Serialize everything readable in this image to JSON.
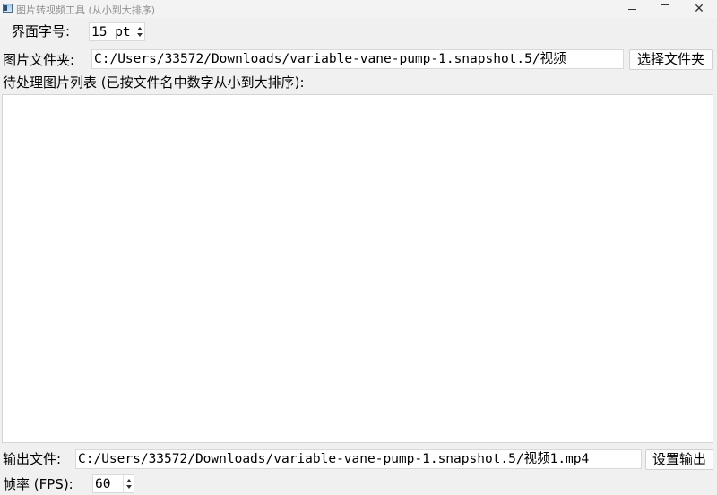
{
  "window": {
    "title": "图片转视频工具 (从小到大排序)",
    "icon": "app-window-icon"
  },
  "font_size": {
    "label": "界面字号:",
    "value": "15 pt"
  },
  "image_folder": {
    "label": "图片文件夹:",
    "value": "C:/Users/33572/Downloads/variable-vane-pump-1.snapshot.5/视频",
    "button": "选择文件夹"
  },
  "image_list": {
    "label": "待处理图片列表 (已按文件名中数字从小到大排序):",
    "items": []
  },
  "output_file": {
    "label": "输出文件:",
    "value": "C:/Users/33572/Downloads/variable-vane-pump-1.snapshot.5/视频1.mp4",
    "button": "设置输出"
  },
  "fps": {
    "label": "帧率 (FPS):",
    "value": "60"
  }
}
